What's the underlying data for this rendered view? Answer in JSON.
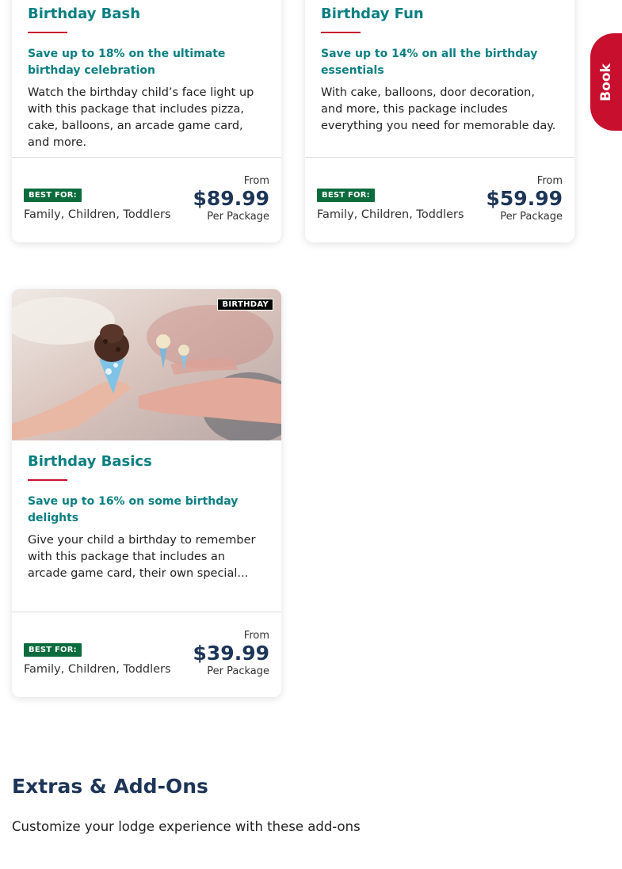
{
  "book_tab": {
    "label": "Book"
  },
  "packages": [
    {
      "title": "Birthday Bash",
      "promo": "Save up to 18% on the ultimate birthday celebration",
      "description": "Watch the birthday child’s face light up with this package that includes pizza, cake, balloons, an arcade game card, and more.",
      "badge": "BEST FOR:",
      "best_for": "Family, Children, Toddlers",
      "from_label": "From",
      "price": "$89.99",
      "unit": "Per Package"
    },
    {
      "title": "Birthday Fun",
      "promo": "Save up to 14% on all the birthday essentials",
      "description": "With cake, balloons, door decoration, and more, this package includes everything you need for memorable day.",
      "badge": "BEST FOR:",
      "best_for": "Family, Children, Toddlers",
      "from_label": "From",
      "price": "$59.99",
      "unit": "Per Package"
    },
    {
      "image_tag": "BIRTHDAY",
      "title": "Birthday Basics",
      "promo": "Save up to 16% on some birthday delights",
      "description": "Give your child a birthday to remember with this package that includes an arcade game card, their own special...",
      "badge": "BEST FOR:",
      "best_for": "Family, Children, Toddlers",
      "from_label": "From",
      "price": "$39.99",
      "unit": "Per Package"
    }
  ],
  "extras": {
    "title": "Extras & Add-Ons",
    "subtitle": "Customize your lodge experience with these add-ons"
  },
  "colors": {
    "accent_teal": "#0b7f82",
    "accent_red": "#c8102e",
    "badge_green": "#0a6b3c",
    "price_navy": "#1d3557"
  }
}
